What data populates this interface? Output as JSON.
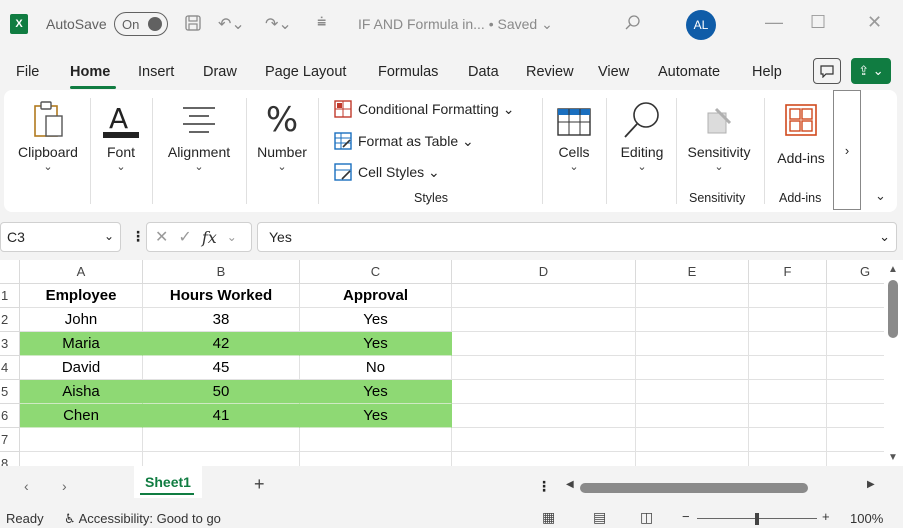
{
  "titlebar": {
    "app_icon": "excel-logo",
    "app_letter": "X",
    "autosave_label": "AutoSave",
    "autosave_state": "On",
    "doc_title": "IF AND Formula in... • Saved",
    "avatar_initials": "AL"
  },
  "menu": {
    "tabs": [
      "File",
      "Home",
      "Insert",
      "Draw",
      "Page Layout",
      "Formulas",
      "Data",
      "Review",
      "View",
      "Automate",
      "Help"
    ],
    "active": "Home"
  },
  "ribbon": {
    "clipboard": "Clipboard",
    "font": "Font",
    "alignment": "Alignment",
    "number": "Number",
    "conditional_formatting": "Conditional Formatting",
    "format_as_table": "Format as Table",
    "cell_styles": "Cell Styles",
    "styles_group": "Styles",
    "cells": "Cells",
    "editing": "Editing",
    "sensitivity": "Sensitivity",
    "sensitivity_group": "Sensitivity",
    "addins": "Add-ins",
    "addins_group": "Add-ins"
  },
  "formula_bar": {
    "name_box": "C3",
    "fx_label": "fx",
    "value": "Yes"
  },
  "grid": {
    "columns": [
      "A",
      "B",
      "C",
      "D",
      "E",
      "F",
      "G"
    ],
    "rows": [
      "1",
      "2",
      "3",
      "4",
      "5",
      "6",
      "7",
      "8"
    ],
    "headers": [
      "Employee",
      "Hours Worked",
      "Approval"
    ],
    "data": [
      {
        "employee": "John",
        "hours": "38",
        "approval": "Yes",
        "highlight": false
      },
      {
        "employee": "Maria",
        "hours": "42",
        "approval": "Yes",
        "highlight": true
      },
      {
        "employee": "David",
        "hours": "45",
        "approval": "No",
        "highlight": false
      },
      {
        "employee": "Aisha",
        "hours": "50",
        "approval": "Yes",
        "highlight": true
      },
      {
        "employee": "Chen",
        "hours": "41",
        "approval": "Yes",
        "highlight": true
      }
    ],
    "highlight_color": "#8ed974"
  },
  "sheets": {
    "tabs": [
      "Sheet1"
    ],
    "add_label": "+"
  },
  "status": {
    "ready": "Ready",
    "accessibility": "Accessibility: Good to go",
    "zoom": "100%"
  },
  "colors": {
    "accent": "#107c41",
    "avatar": "#0f5ca8"
  }
}
